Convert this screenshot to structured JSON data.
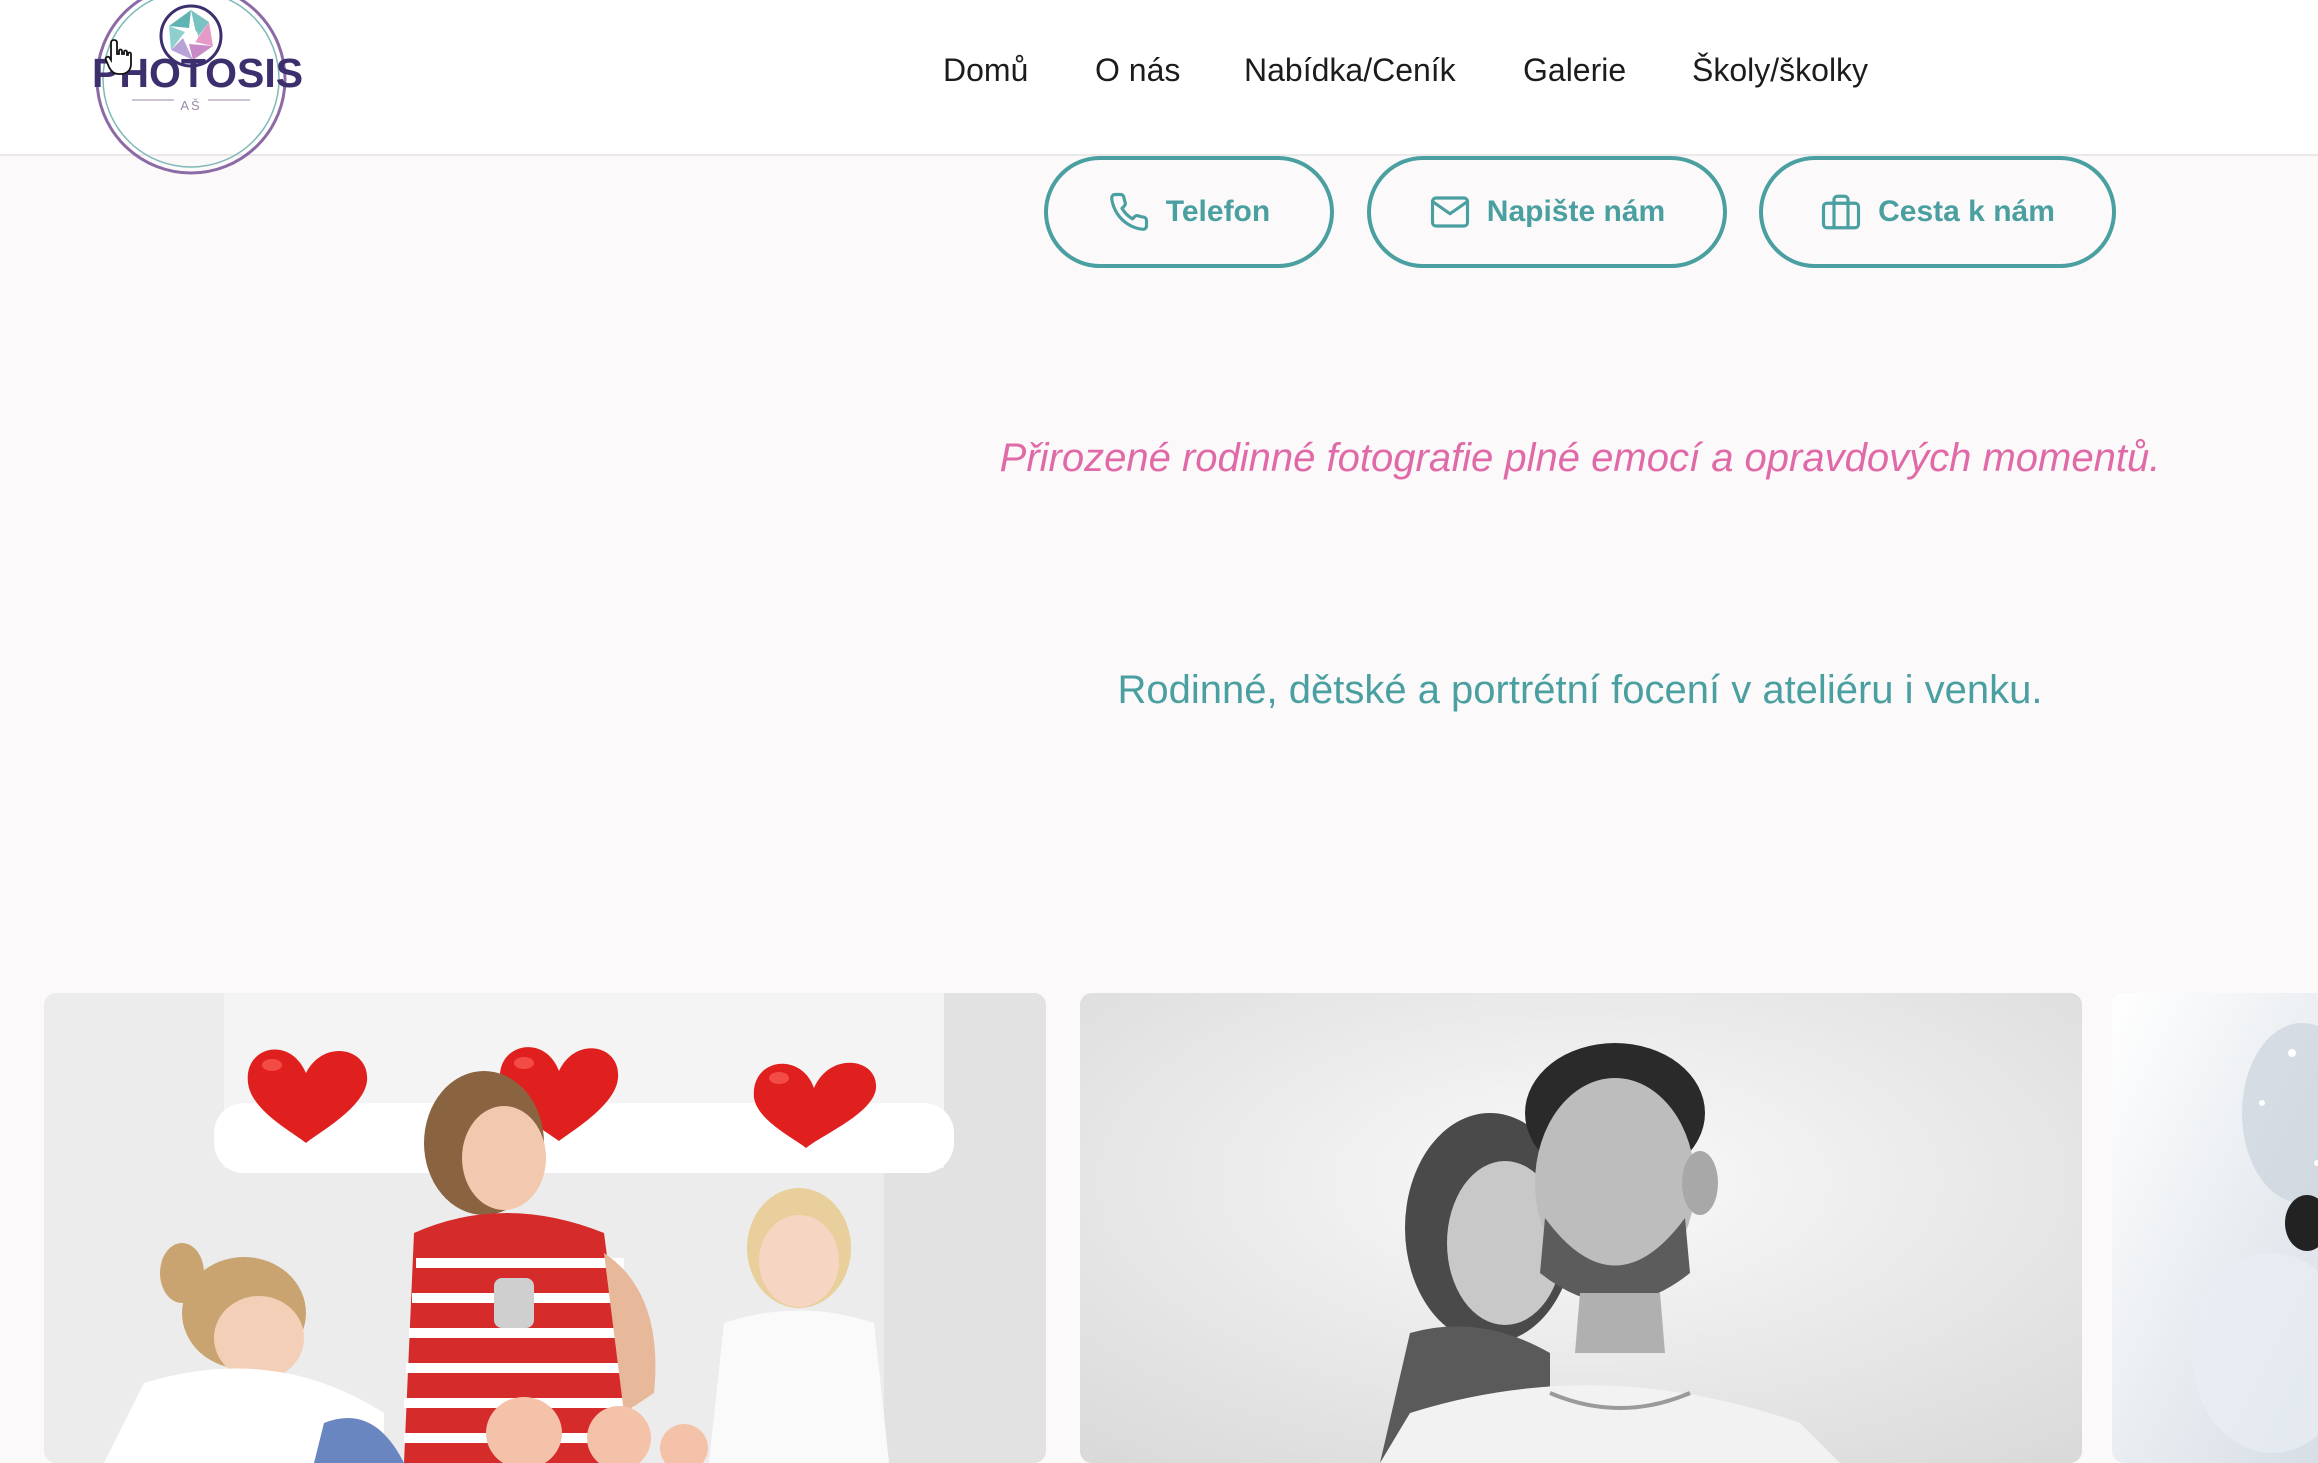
{
  "header": {
    "logo": {
      "text": "PHOTOSIS",
      "subtext": "AŠ"
    },
    "nav": [
      {
        "label": "Domů"
      },
      {
        "label": "O nás"
      },
      {
        "label": "Nabídka/Ceník"
      },
      {
        "label": "Galerie"
      },
      {
        "label": "Školy/školky"
      }
    ]
  },
  "contact_buttons": [
    {
      "label": "Telefon",
      "icon": "phone-icon"
    },
    {
      "label": "Napište nám",
      "icon": "mail-icon"
    },
    {
      "label": "Cesta k nám",
      "icon": "briefcase-icon"
    }
  ],
  "hero": {
    "tagline": "Přirozené rodinné fotografie plné emocí a opravdových momentů.",
    "subline": "Rodinné, dětské a portrétní focení v ateliéru i venku."
  },
  "gallery": {
    "cards": [
      {
        "subject": "family-photo-color"
      },
      {
        "subject": "couple-photo-bw"
      },
      {
        "subject": "winter-photo-partial"
      }
    ]
  },
  "colors": {
    "accent_teal": "#4a9fa0",
    "accent_pink": "#e06aa8",
    "logo_purple": "#3d2f6e",
    "page_background": "#fcf9fa"
  }
}
